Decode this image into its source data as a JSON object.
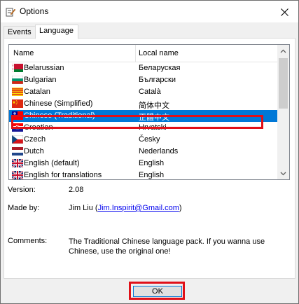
{
  "window": {
    "title": "Options",
    "close_icon": "close-icon",
    "title_icon": "options-app-icon"
  },
  "tabs": [
    {
      "label": "Events",
      "active": false
    },
    {
      "label": "Language",
      "active": true
    }
  ],
  "list": {
    "columns": {
      "name": "Name",
      "local": "Local name"
    },
    "rows": [
      {
        "name": "Belarussian",
        "local": "Беларуская",
        "flag": "belarus-flag-icon",
        "selected": false
      },
      {
        "name": "Bulgarian",
        "local": "Български",
        "flag": "bulgaria-flag-icon",
        "selected": false
      },
      {
        "name": "Catalan",
        "local": "Català",
        "flag": "catalonia-flag-icon",
        "selected": false
      },
      {
        "name": "Chinese (Simplified)",
        "local": "简体中文",
        "flag": "china-flag-icon",
        "selected": false
      },
      {
        "name": "Chinese (Traditional)",
        "local": "正體中文",
        "flag": "taiwan-flag-icon",
        "selected": true
      },
      {
        "name": "Croatian",
        "local": "Hrvatski",
        "flag": "croatia-flag-icon",
        "selected": false
      },
      {
        "name": "Czech",
        "local": "Česky",
        "flag": "czech-flag-icon",
        "selected": false
      },
      {
        "name": "Dutch",
        "local": "Nederlands",
        "flag": "netherlands-flag-icon",
        "selected": false
      },
      {
        "name": "English (default)",
        "local": "English",
        "flag": "uk-flag-icon",
        "selected": false
      },
      {
        "name": "English for translations",
        "local": "English",
        "flag": "uk-flag-icon",
        "selected": false
      }
    ]
  },
  "info": {
    "version_label": "Version:",
    "version_value": "2.08",
    "made_by_label": "Made by:",
    "made_by_name": "Jim Liu (",
    "made_by_email": "Jim.Inspirit@Gmail.com",
    "made_by_close": ")",
    "comments_label": "Comments:",
    "comments_value": "The Traditional Chinese language pack. If you wanna use Chinese, use the original one!"
  },
  "buttons": {
    "ok_label": "OK"
  },
  "colors": {
    "selection": "#0078d7",
    "highlight_outline": "#e01018",
    "link": "#0000ee"
  }
}
